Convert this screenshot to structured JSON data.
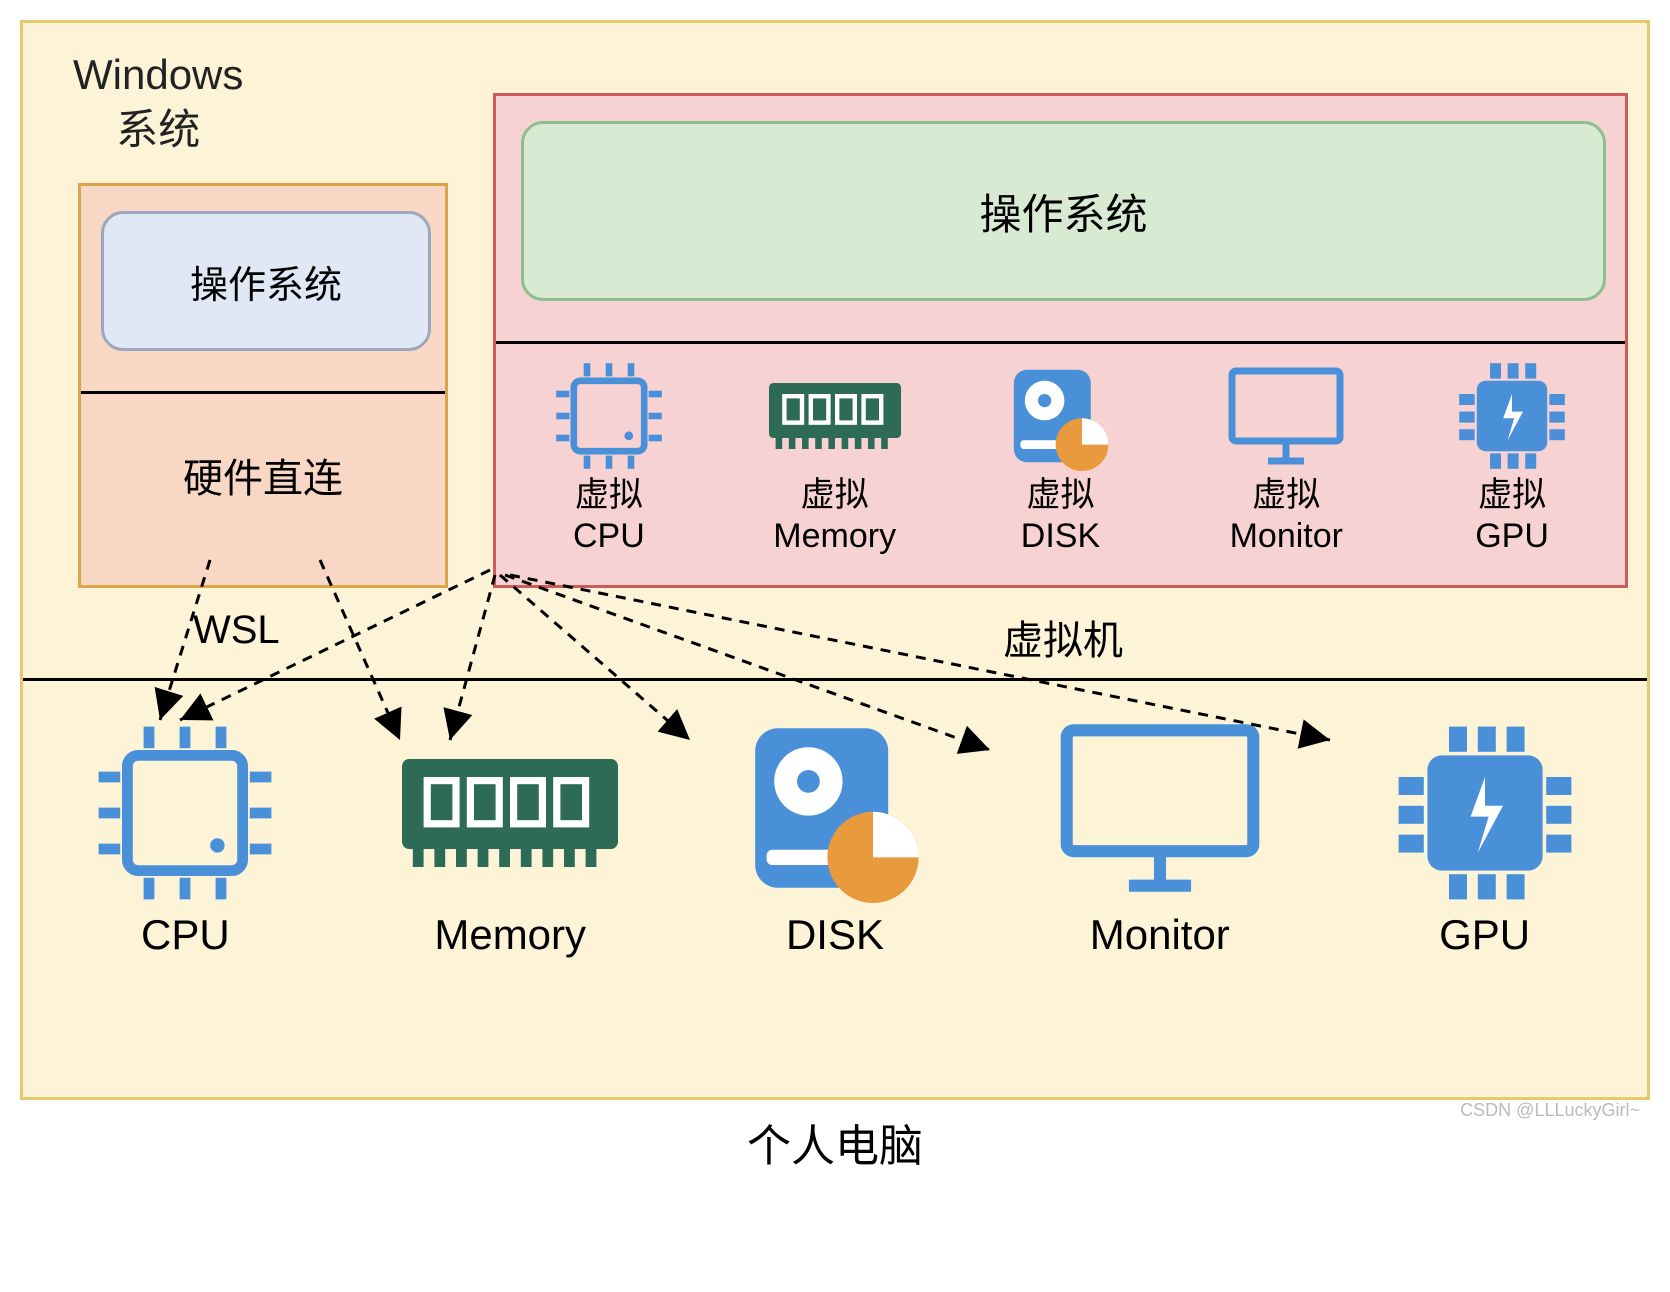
{
  "windows_title_line1": "Windows",
  "windows_title_line2": "系统",
  "wsl": {
    "os_label": "操作系统",
    "hw_label": "硬件直连",
    "name": "WSL"
  },
  "vm": {
    "os_label": "操作系统",
    "name": "虚拟机",
    "hw": [
      {
        "label1": "虚拟",
        "label2": "CPU"
      },
      {
        "label1": "虚拟",
        "label2": "Memory"
      },
      {
        "label1": "虚拟",
        "label2": "DISK"
      },
      {
        "label1": "虚拟",
        "label2": "Monitor"
      },
      {
        "label1": "虚拟",
        "label2": "GPU"
      }
    ]
  },
  "hw": [
    {
      "label": "CPU"
    },
    {
      "label": "Memory"
    },
    {
      "label": "DISK"
    },
    {
      "label": "Monitor"
    },
    {
      "label": "GPU"
    }
  ],
  "bottom_label": "个人电脑",
  "watermark": "CSDN @LLLuckyGirl~",
  "colors": {
    "stage_bg": "#fdf4d8",
    "wsl_bg": "#f8d7c5",
    "vm_bg": "#f6d2d2",
    "os_wsl_bg": "#e0e8f5",
    "os_vm_bg": "#d9ead3",
    "cpu_outline": "#4a90d9",
    "memory_fill": "#2e6b57",
    "disk_fill": "#4a90d9",
    "disk_accent": "#e89a3c",
    "monitor_outline": "#4a90d9",
    "gpu_fill": "#4a90d9"
  }
}
